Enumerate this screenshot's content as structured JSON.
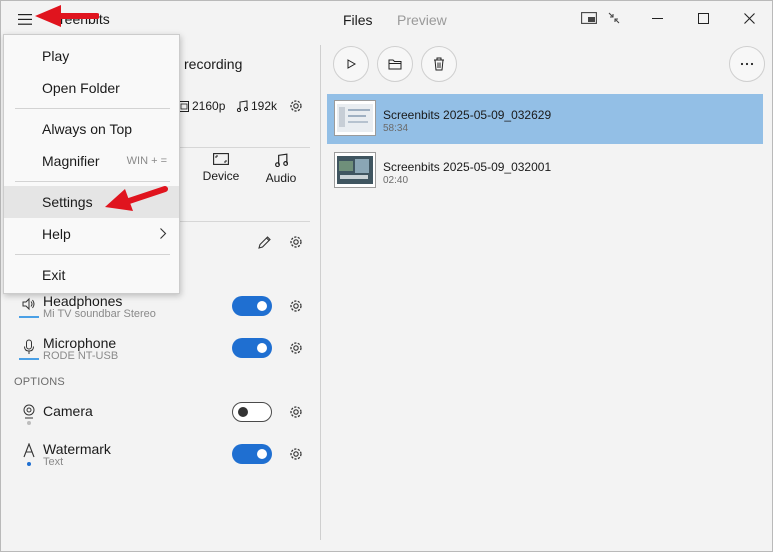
{
  "app": {
    "title": "Screenbits",
    "title_visible": "creenbits"
  },
  "tabs": [
    {
      "label": "Files",
      "active": true
    },
    {
      "label": "Preview",
      "active": false
    }
  ],
  "recording": {
    "label_partial": "recording",
    "resolution": "2160p",
    "audio_bitrate": "192k"
  },
  "sources": [
    {
      "label": "Device",
      "icon": "screen-region-icon"
    },
    {
      "label": "Audio",
      "icon": "music-note-icon"
    }
  ],
  "audio": [
    {
      "title": "Headphones",
      "subtitle": "Mi TV soundbar Stereo",
      "enabled": true,
      "icon": "speaker-icon",
      "level": 0.1
    },
    {
      "title": "Microphone",
      "subtitle": "RODE NT-USB",
      "enabled": true,
      "icon": "microphone-icon",
      "level": 0.05
    }
  ],
  "options_header": "OPTIONS",
  "options": [
    {
      "title": "Camera",
      "subtitle": "",
      "enabled": false,
      "icon": "webcam-icon"
    },
    {
      "title": "Watermark",
      "subtitle": "Text",
      "enabled": true,
      "icon": "text-watermark-icon"
    }
  ],
  "files": [
    {
      "name": "Screenbits 2025-05-09_032629",
      "duration": "58:34",
      "selected": true
    },
    {
      "name": "Screenbits 2025-05-09_032001",
      "duration": "02:40",
      "selected": false
    }
  ],
  "menu": {
    "items": [
      {
        "label": "Play"
      },
      {
        "label": "Open Folder"
      },
      {
        "label": "Always on Top"
      },
      {
        "label": "Magnifier",
        "shortcut": "WIN + ="
      },
      {
        "label": "Settings",
        "highlighted": true
      },
      {
        "label": "Help",
        "submenu": true
      },
      {
        "label": "Exit"
      }
    ]
  },
  "colors": {
    "accent": "#1f6fd1",
    "selection": "#93bfe6",
    "annotation_arrow": "#e0141e"
  }
}
